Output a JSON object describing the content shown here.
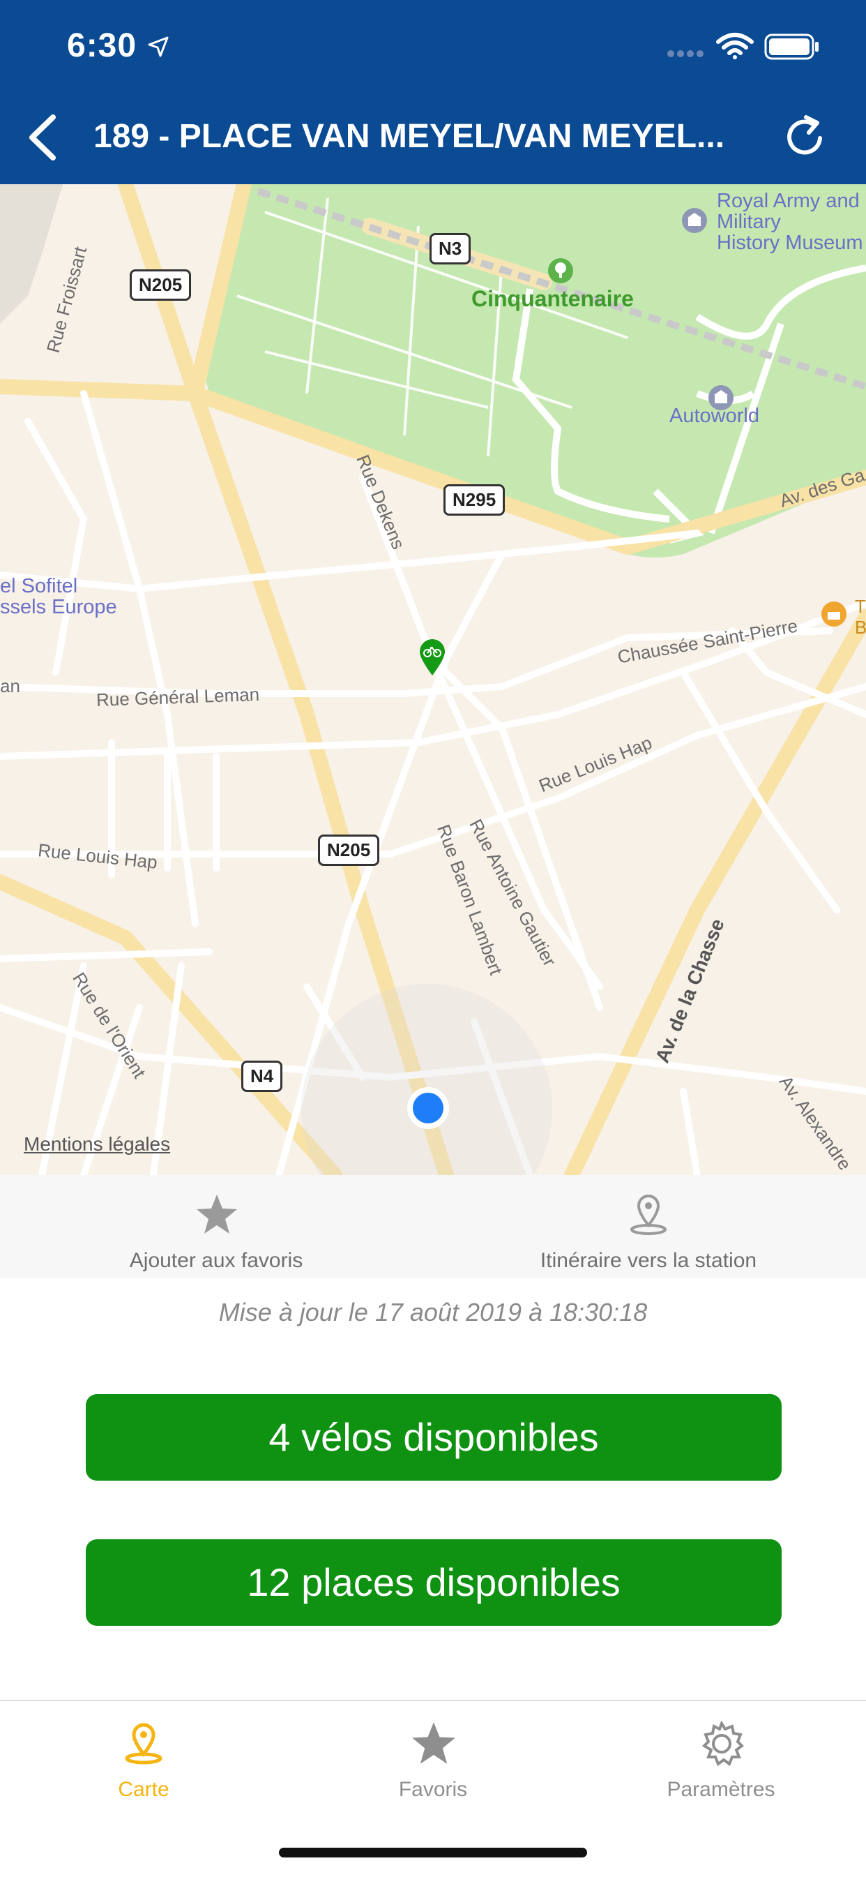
{
  "status_bar": {
    "time": "6:30"
  },
  "header": {
    "title": "189 - PLACE VAN MEYEL/VAN MEYEL..."
  },
  "map": {
    "labels": {
      "royal_army": "Royal Army and",
      "military": "Military",
      "history": "History Museum",
      "cinquantenaire": "Cinquantenaire",
      "autoworld": "Autoworld",
      "rue_froissart": "Rue Froissart",
      "rue_dekens": "Rue Dekens",
      "av_des_gaulois": "Av. des Ga",
      "sofitel1": "el Sofitel",
      "sofitel2": "ssels Europe",
      "an": "an",
      "rue_general_leman": "Rue Général Leman",
      "chaussee": "Chaussée Saint-Pierre",
      "rue_louis_hap_east": "Rue Louis Hap",
      "rue_louis_hap_west": "Rue Louis Hap",
      "rue_baron_lambert": "Rue Baron Lambert",
      "rue_antoine_gautier": "Rue Antoine Gautier",
      "av_de_la_chasse": "Av. de la Chasse",
      "rue_de_lorient": "Rue de l'Orient",
      "av_alexandre": "Av. Alexandre",
      "t": "T",
      "b": "B"
    },
    "shields": {
      "n205_top": "N205",
      "n3": "N3",
      "n295": "N295",
      "n205_mid": "N205",
      "n4": "N4"
    },
    "legal": "Mentions légales"
  },
  "actions": {
    "favorite": {
      "label": "Ajouter aux favoris"
    },
    "route": {
      "label": "Itinéraire vers la station"
    }
  },
  "update_text": "Mise à jour le 17 août 2019 à 18:30:18",
  "availability": {
    "bikes": "4 vélos disponibles",
    "places": "12 places disponibles"
  },
  "tabs": [
    {
      "label": "Carte",
      "active": true
    },
    {
      "label": "Favoris",
      "active": false
    },
    {
      "label": "Paramètres",
      "active": false
    }
  ],
  "colors": {
    "header_bg": "#0a4b94",
    "available_green": "#0f9112",
    "active_tab": "#f5b40f",
    "inactive_tab": "#8e8e8e"
  }
}
